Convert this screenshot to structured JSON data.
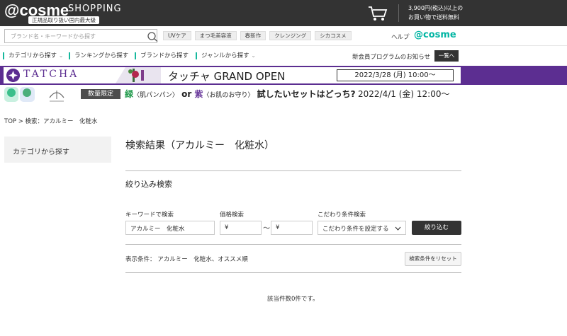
{
  "header": {
    "logo": "@cosme",
    "logo_suffix": "SHOPPING",
    "tagline": "正規品取り扱い国内最大級",
    "shipping_line1": "3,900円(税込)以上の",
    "shipping_line2": "お買い物で送料無料"
  },
  "search": {
    "placeholder": "ブランド名・キーワードから探す",
    "tags": [
      "UVケア",
      "まつ毛美容液",
      "春新作",
      "クレンジング",
      "シカコスメ"
    ],
    "help": "ヘルプ",
    "cosme_link": "@cosme"
  },
  "nav": {
    "items": [
      "カテゴリから探す",
      "ランキングから探す",
      "ブランドから探す",
      "ジャンルから探す"
    ],
    "news": "新会員プログラムのお知らせ",
    "list_button": "一覧へ"
  },
  "banner1": {
    "brand": "TATCHA",
    "headline": "タッチャ GRAND OPEN",
    "date": "2022/3/28 (月) 10:00〜"
  },
  "banner2": {
    "badge": "数量限定",
    "text_green": "緑",
    "text_green_note": "〈肌パンパン〉",
    "text_or": " or ",
    "text_purple": "紫",
    "text_purple_note": "〈お肌のお守り〉",
    "text_tail": " 試したいセットはどっち?",
    "date": "2022/4/1 (金) 12:00〜"
  },
  "breadcrumb": "TOP > 検索：アカルミー　化粧水",
  "sidebar": {
    "category_label": "カテゴリから探す"
  },
  "main": {
    "title": "検索結果（アカルミー　化粧水）",
    "filter_title": "絞り込み検索",
    "keyword_label": "キーワードで検索",
    "keyword_value": "アカルミー　化粧水",
    "price_label": "価格検索",
    "price_min": "¥",
    "price_tilde": "〜",
    "price_max": "¥",
    "condition_label": "こだわり条件検索",
    "condition_select": "こだわり条件を設定する",
    "submit": "絞り込む",
    "display_condition": "表示条件：  アカルミー　化粧水、オススメ順",
    "reset": "検索条件をリセット",
    "result": "該当件数0件です。"
  },
  "colors": {
    "header_bg": "#333333",
    "accent_green": "#16b89d",
    "tatcha_purple": "#5c2e91"
  }
}
